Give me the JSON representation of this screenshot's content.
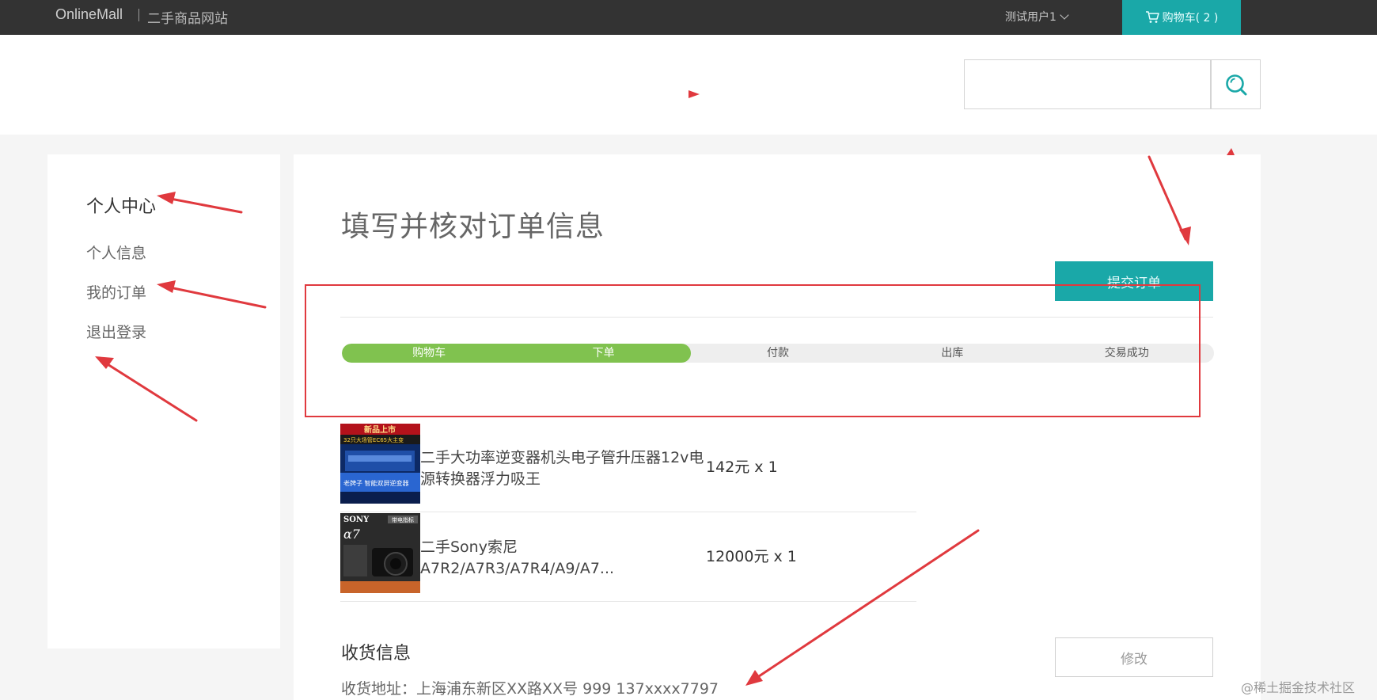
{
  "topbar": {
    "brand": "OnlineMall",
    "brand_sub": "二手商品网站",
    "user_name": "测试用户1",
    "cart_label": "购物车( 2 )"
  },
  "search": {
    "placeholder": ""
  },
  "sidebar": {
    "title": "个人中心",
    "items": [
      {
        "label": "个人信息"
      },
      {
        "label": "我的订单"
      },
      {
        "label": "退出登录"
      }
    ]
  },
  "main": {
    "title": "填写并核对订单信息",
    "submit_label": "提交订单",
    "progress": {
      "completed_steps": 2,
      "steps": [
        {
          "label": "购物车"
        },
        {
          "label": "下单"
        },
        {
          "label": "付款"
        },
        {
          "label": "出库"
        },
        {
          "label": "交易成功"
        }
      ]
    },
    "products": [
      {
        "name": "二手大功率逆变器机头电子管升压器12v电源转换器浮力吸王",
        "price": "142元 x 1",
        "thumb": {
          "banner": "新品上市",
          "line1": "32只大场管EC65大主变",
          "line2": "老牌子 智能双屏逆变器"
        }
      },
      {
        "name": "二手Sony索尼A7R2/A7R3/A7R4/A9/A7...",
        "price": "12000元 x 1",
        "thumb": {
          "brand": "SONY",
          "model": "α7",
          "tag": "带电指标"
        }
      }
    ],
    "shipping": {
      "title": "收货信息",
      "address": "收货地址：上海浦东新区XX路XX号 999 137xxxx7797",
      "edit_label": "修改"
    }
  },
  "watermark": "@稀土掘金技术社区",
  "colors": {
    "topbar": "#333333",
    "accent": "#1aa8a8",
    "progress_done": "#80c24f",
    "annotation": "#e0393e"
  }
}
